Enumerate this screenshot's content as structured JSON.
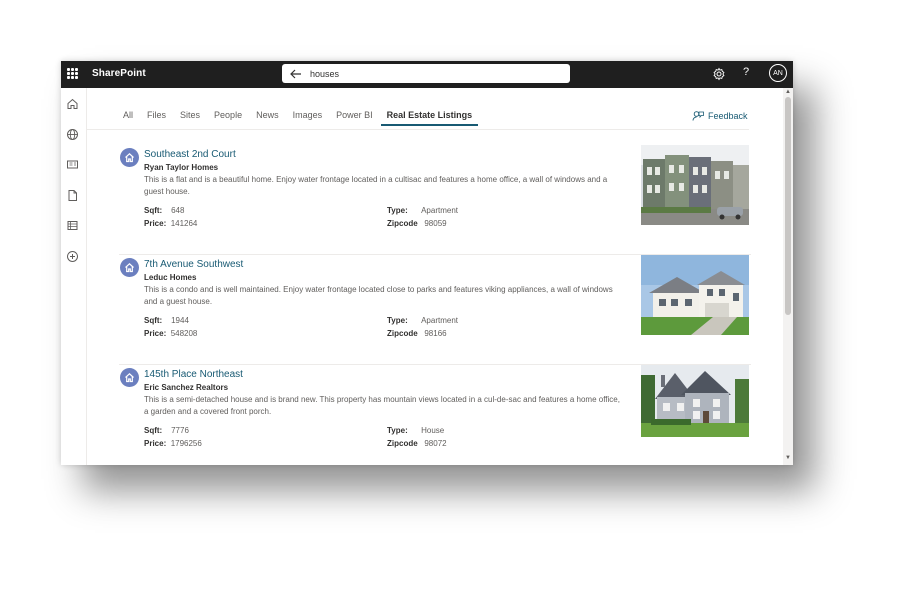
{
  "app": {
    "name": "SharePoint"
  },
  "search": {
    "query": "houses"
  },
  "header": {
    "help": "?",
    "avatar_initials": "AN"
  },
  "tabs": [
    {
      "label": "All"
    },
    {
      "label": "Files"
    },
    {
      "label": "Sites"
    },
    {
      "label": "People"
    },
    {
      "label": "News"
    },
    {
      "label": "Images"
    },
    {
      "label": "Power BI"
    },
    {
      "label": "Real Estate Listings",
      "active": true
    }
  ],
  "feedback": {
    "label": "Feedback"
  },
  "results": [
    {
      "title": "Southeast 2nd Court",
      "company": "Ryan Taylor Homes",
      "description": "This is a flat and is a beautiful home. Enjoy water frontage located in a cultisac and features a home office, a wall of windows and a guest house.",
      "sqft_label": "Sqft:",
      "sqft": "648",
      "price_label": "Price:",
      "price": "141264",
      "type_label": "Type:",
      "type": "Apartment",
      "zip_label": "Zipcode",
      "zipcode": "98059"
    },
    {
      "title": "7th Avenue Southwest",
      "company": "Leduc Homes",
      "description": "This is a condo and is well maintained. Enjoy water frontage located close to parks and features viking appliances, a wall of windows and a guest house.",
      "sqft_label": "Sqft:",
      "sqft": "1944",
      "price_label": "Price:",
      "price": "548208",
      "type_label": "Type:",
      "type": "Apartment",
      "zip_label": "Zipcode",
      "zipcode": "98166"
    },
    {
      "title": "145th Place Northeast",
      "company": "Eric Sanchez Realtors",
      "description": "This is a semi-detached house and is brand new. This property has mountain views located in a cul-de-sac and features a home office, a garden and a covered front porch.",
      "sqft_label": "Sqft:",
      "sqft": "7776",
      "price_label": "Price:",
      "price": "1796256",
      "type_label": "Type:",
      "type": "House",
      "zip_label": "Zipcode",
      "zipcode": "98072"
    }
  ],
  "colors": {
    "topbar": "#1f1f1f",
    "accent": "#185a73",
    "house_badge": "#6b7fbf"
  },
  "icons": [
    "app-launcher-icon",
    "back-arrow-icon",
    "gear-icon",
    "help-icon",
    "home-icon",
    "globe-icon",
    "news-icon",
    "document-icon",
    "list-icon",
    "add-icon",
    "feedback-icon",
    "house-icon"
  ]
}
